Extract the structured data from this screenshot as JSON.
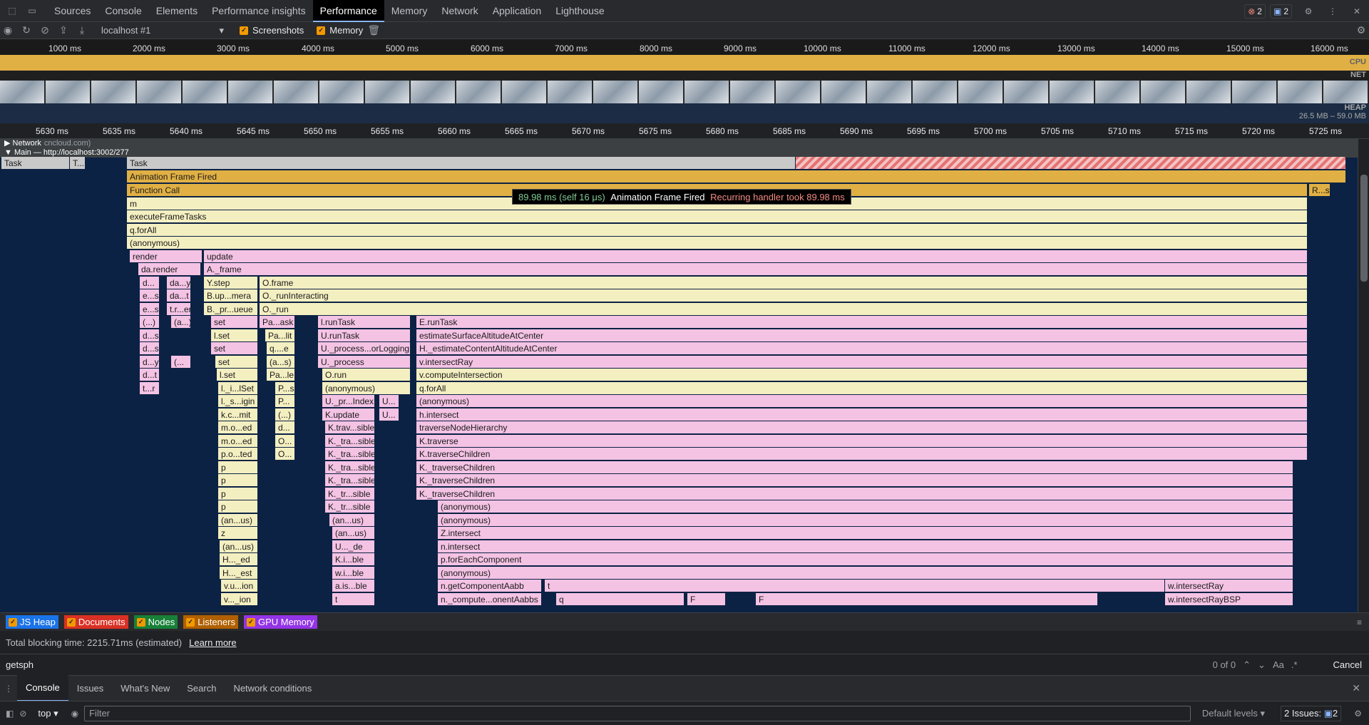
{
  "topbar": {
    "tabs": [
      "Sources",
      "Console",
      "Elements",
      "Performance insights",
      "Performance",
      "Memory",
      "Network",
      "Application",
      "Lighthouse"
    ],
    "errors": "2",
    "issues": "2"
  },
  "toolbar": {
    "target": "localhost #1",
    "screenshots_label": "Screenshots",
    "memory_label": "Memory"
  },
  "overview": {
    "ticks": [
      "1000 ms",
      "2000 ms",
      "3000 ms",
      "4000 ms",
      "5000 ms",
      "6000 ms",
      "7000 ms",
      "8000 ms",
      "9000 ms",
      "10000 ms",
      "11000 ms",
      "12000 ms",
      "13000 ms",
      "14000 ms",
      "15000 ms",
      "16000 ms"
    ],
    "cpu_label": "CPU",
    "net_label": "NET",
    "heap_label": "HEAP",
    "heap_range": "26.5 MB – 59.0 MB"
  },
  "detail_ruler": [
    "5630 ms",
    "5635 ms",
    "5640 ms",
    "5645 ms",
    "5650 ms",
    "5655 ms",
    "5660 ms",
    "5665 ms",
    "5670 ms",
    "5675 ms",
    "5680 ms",
    "5685 ms",
    "5690 ms",
    "5695 ms",
    "5700 ms",
    "5705 ms",
    "5710 ms",
    "5715 ms",
    "5720 ms",
    "5725 ms"
  ],
  "tracks": {
    "network": "Network",
    "network_suffix": "cncloud.com)",
    "main": "Main — http://localhost:3002/277"
  },
  "flame": {
    "task": "Task",
    "task_small": "Task",
    "task_t": "T...",
    "animation": "Animation Frame Fired",
    "function_call": "Function Call",
    "rs": "R...s",
    "m": "m",
    "execute": "executeFrameTasks",
    "forall": "q.forAll",
    "anon": "(anonymous)",
    "render": "render",
    "update": "update",
    "da_render": "da.render",
    "a_frame": "A._frame",
    "ystep": "Y.step",
    "oframe": "O.frame",
    "bup": "B.up...mera",
    "orun_int": "O._runInteracting",
    "bpr": "B._pr...ueue",
    "orun": "O._run",
    "set": "set",
    "pask": "Pa...ask",
    "lruntask": "l.runTask",
    "eruntask": "E.runTask",
    "lset": "l.set",
    "palit": "Pa...lit",
    "uruntask": "U.runTask",
    "estimate": "estimateSurfaceAltitudeAtCenter",
    "set2": "set",
    "qe": "q....e",
    "uprocess_log": "U._process...orLogging",
    "h_estimate": "H._estimateContentAltitudeAtCenter",
    "set3": "set",
    "as": "(a...s)",
    "uprocess": "U._process",
    "vintersect": "v.intersectRay",
    "lset2": "l.set",
    "pale": "Pa...le",
    "orun2": "O.run",
    "vcompute": "v.computeIntersection",
    "lilset": "l._i...lSet",
    "ps": "P...s",
    "anon2": "(anonymous)",
    "qforall2": "q.forAll",
    "lsigin": "l._s...igin",
    "ppr": "U._pr...Index",
    "u": "U...",
    "anon3": "(anonymous)",
    "kcmit": "k.c...mit",
    "kupdate": "K.update",
    "hintersect": "h.intersect",
    "mod": "m.o...ed",
    "ktrav": "K.trav...sible",
    "traverse_hier": "traverseNodeHierarchy",
    "mod2": "m.o...ed",
    "ktra": "K._tra...sible",
    "ktraverse": "K.traverse",
    "poted": "p.o...ted",
    "ktra2": "K._tra...sible",
    "ktrav_child": "K.traverseChildren",
    "p1": "p",
    "ktra3": "K._tra...sible",
    "ktrav_child2": "K._traverseChildren",
    "p2": "p",
    "ktra4": "K._tra...sible",
    "ktrav_child3": "K._traverseChildren",
    "p3": "p",
    "ktr": "K._tr...sible",
    "ktrav_child4": "K._traverseChildren",
    "p4": "p",
    "ktr2": "K._tr...sible",
    "anon4": "(anonymous)",
    "anus": "(an...us)",
    "anus2": "(an...us)",
    "anon5": "(anonymous)",
    "z": "z",
    "anus3": "(an...us)",
    "zintersect": "Z.intersect",
    "anus4": "(an...us)",
    "ude": "U..._de",
    "nintersect": "n.intersect",
    "hed": "H..._ed",
    "kible": "K.i...ble",
    "pforeach": "p.forEachComponent",
    "hest": "H..._est",
    "wible": "w.i...ble",
    "anon6": "(anonymous)",
    "vuion": "v.u...ion",
    "aisble": "a.is...ble",
    "ngetcomp": "n.getComponentAabb",
    "t": "t",
    "wintersectray": "w.intersectRay",
    "vion": "v..._ion",
    "t2": "t",
    "ncompute": "n._compute...onentAabbs",
    "q": "q",
    "F": "F",
    "F2": "F",
    "wintersectbsp": "w.intersectRayBSP"
  },
  "tooltip": {
    "time": "89.98 ms (self 16 μs)",
    "name": "Animation Frame Fired",
    "warning": "Recurring handler took 89.98 ms"
  },
  "counters": [
    "JS Heap",
    "Documents",
    "Nodes",
    "Listeners",
    "GPU Memory"
  ],
  "counter_colors": [
    "#1a73e8",
    "#d93025",
    "#188038",
    "#b06000",
    "#9334e6"
  ],
  "summary": {
    "text": "Total blocking time: 2215.71ms (estimated)",
    "link": "Learn more"
  },
  "search": {
    "query": "getsph",
    "count": "0 of 0",
    "case": "Aa",
    "regex": ".*",
    "cancel": "Cancel"
  },
  "drawer": {
    "tabs": [
      "Console",
      "Issues",
      "What's New",
      "Search",
      "Network conditions"
    ]
  },
  "console": {
    "context": "top",
    "filter_placeholder": "Filter",
    "levels": "Default levels",
    "issues": "2 Issues:",
    "issues_count": "2"
  }
}
